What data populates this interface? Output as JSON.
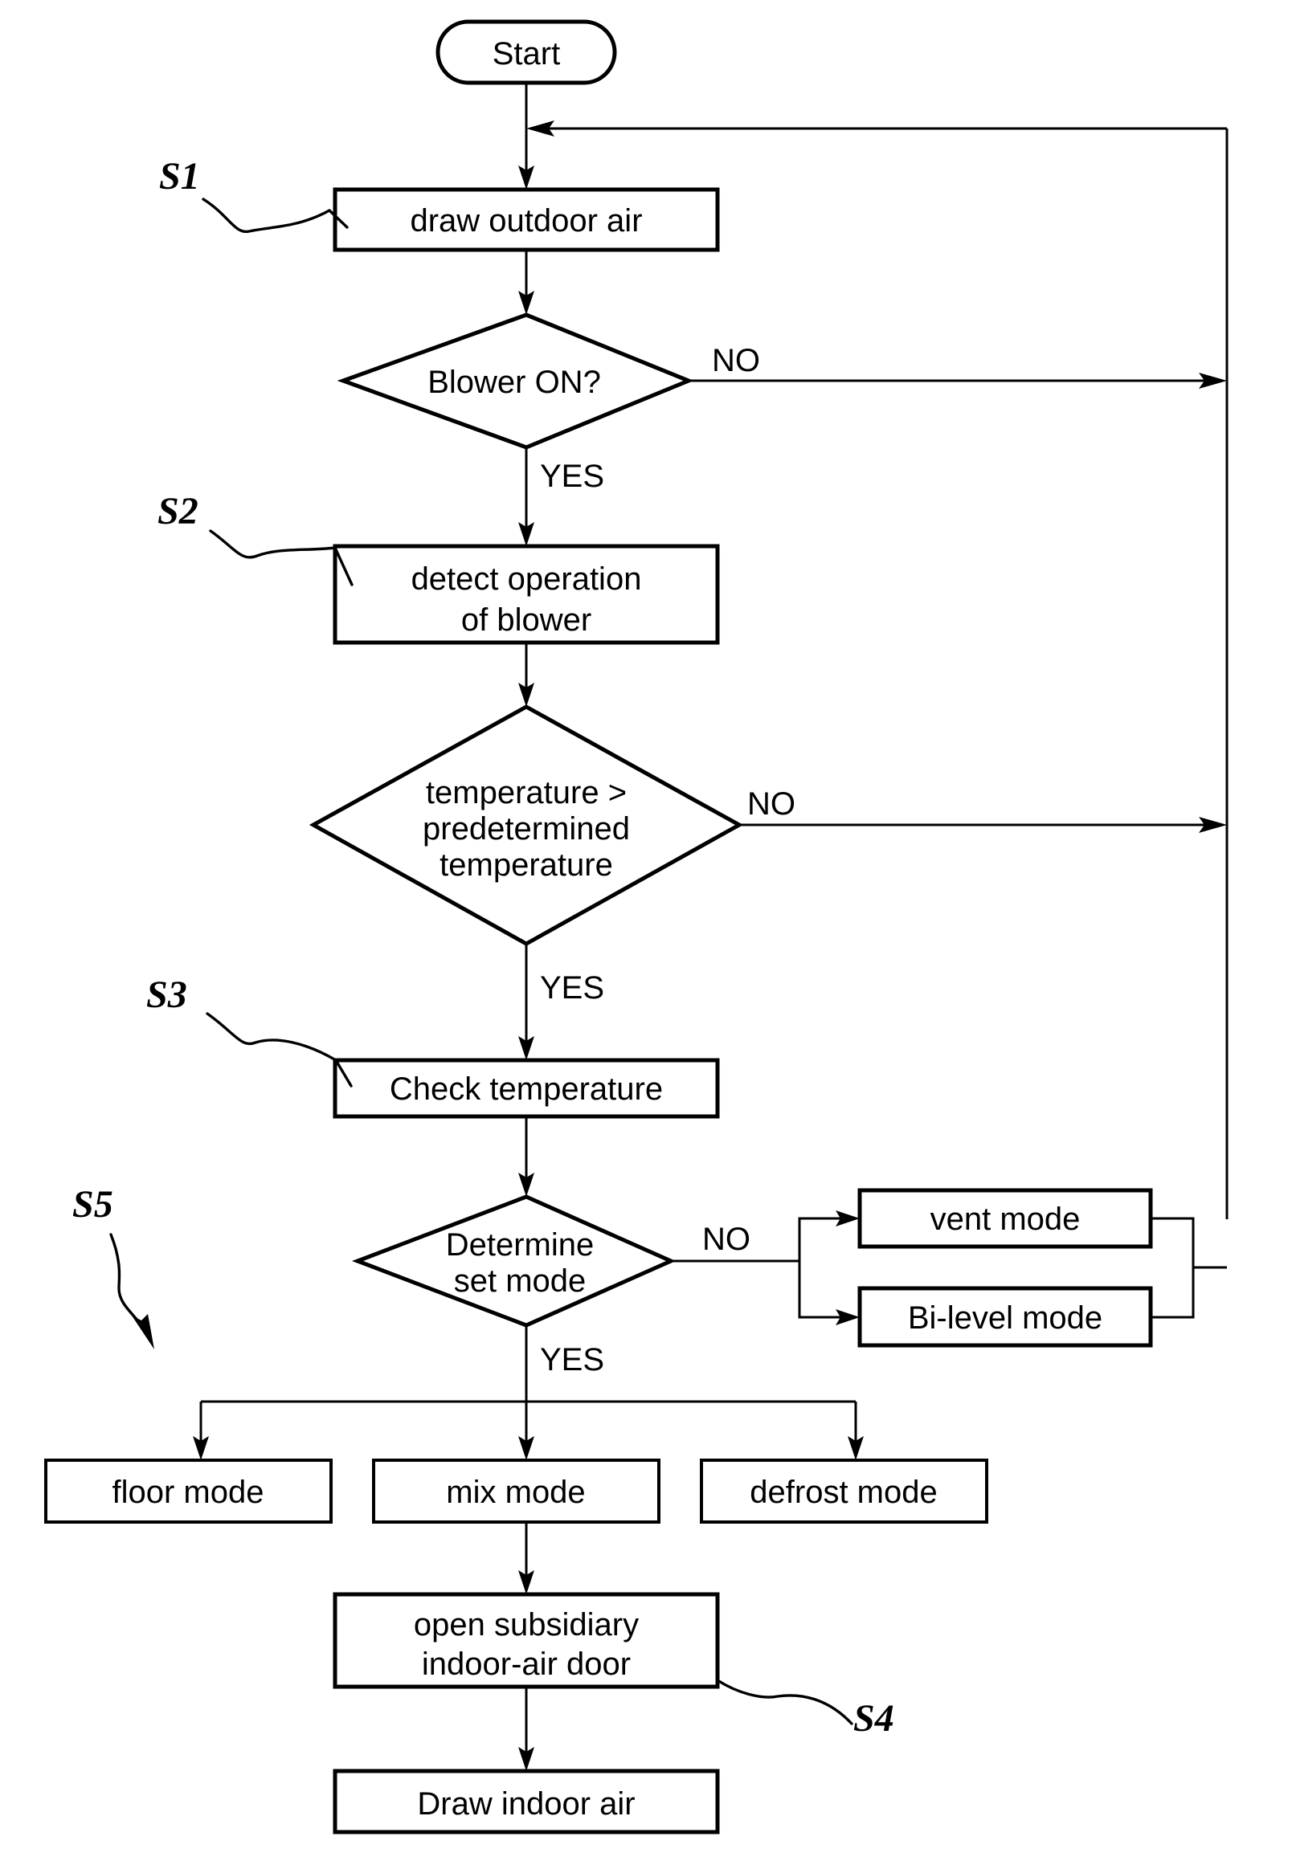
{
  "diagram": {
    "title": "HVAC air-intake control flowchart",
    "stroke_color": "#000000",
    "background_color": "#ffffff"
  },
  "nodes": {
    "start": {
      "label": "Start",
      "shape": "terminator"
    },
    "draw_outdoor_air": {
      "label": "draw outdoor air",
      "shape": "process"
    },
    "blower_on": {
      "label": "Blower ON?",
      "shape": "decision"
    },
    "detect_blower": {
      "line1": "detect operation",
      "line2": "of blower",
      "shape": "process"
    },
    "temp_compare": {
      "line1": "temperature >",
      "line2": "predetermined",
      "line3": "temperature",
      "shape": "decision"
    },
    "check_temperature": {
      "label": "Check temperature",
      "shape": "process"
    },
    "determine_set_mode": {
      "line1": "Determine",
      "line2": "set mode",
      "shape": "decision"
    },
    "vent_mode": {
      "label": "vent mode",
      "shape": "process"
    },
    "bi_level_mode": {
      "label": "Bi-level mode",
      "shape": "process"
    },
    "floor_mode": {
      "label": "floor mode",
      "shape": "process"
    },
    "mix_mode": {
      "label": "mix mode",
      "shape": "process"
    },
    "defrost_mode": {
      "label": "defrost mode",
      "shape": "process"
    },
    "open_door": {
      "line1": "open subsidiary",
      "line2": "indoor-air door",
      "shape": "process"
    },
    "draw_indoor_air": {
      "label": "Draw indoor air",
      "shape": "process"
    }
  },
  "branch_labels": {
    "blower_no": "NO",
    "blower_yes": "YES",
    "temp_no": "NO",
    "temp_yes": "YES",
    "mode_no": "NO",
    "mode_yes": "YES"
  },
  "step_labels": {
    "s1": "S1",
    "s2": "S2",
    "s3": "S3",
    "s4": "S4",
    "s5": "S5"
  }
}
